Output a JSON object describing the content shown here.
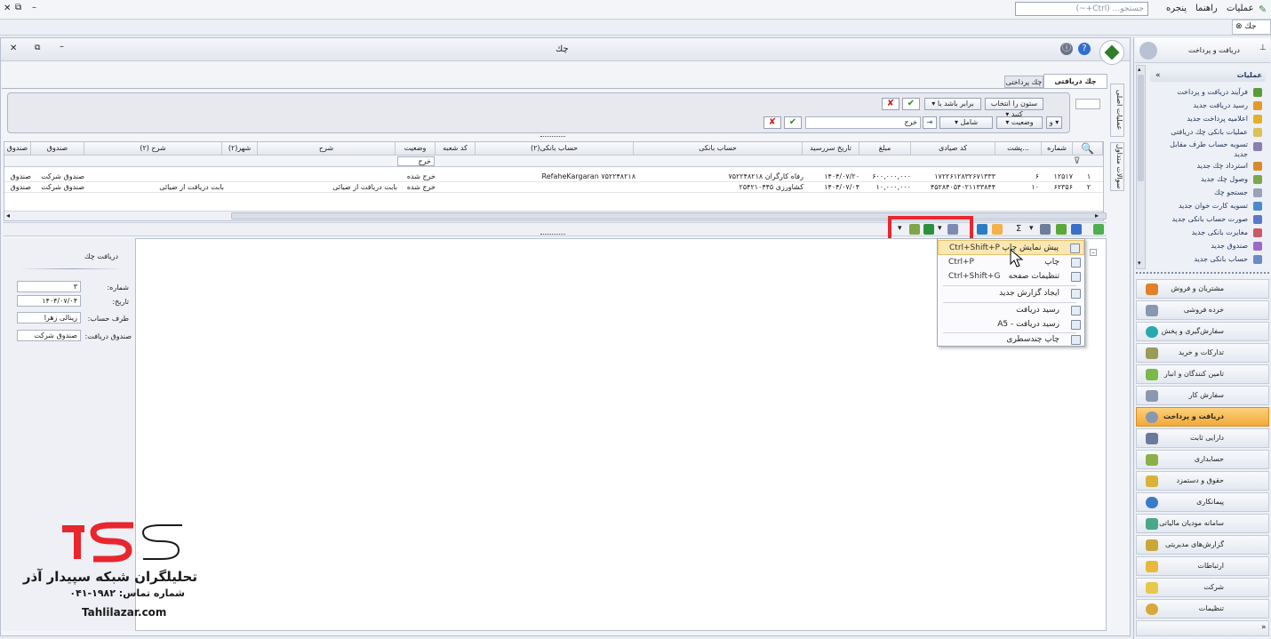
{
  "app": {
    "window_title": "چك",
    "doc_tab": "جك",
    "search_placeholder": "جستجو... (Ctrl+~)",
    "menu": [
      "عملیات",
      "راهنما",
      "پنجره"
    ]
  },
  "tabs": [
    "چك دریافتی",
    "چك پرداختی"
  ],
  "vertical_tabs": [
    "عملیات اصلی",
    "سوالات متداول"
  ],
  "filter": {
    "row1": {
      "column_dropdown": "ستون را انتخاب کنید",
      "operator_dropdown": "برابر باشد با"
    },
    "row2": {
      "logic": "و",
      "field": "وضعیت",
      "operator": "شامل",
      "value": "خرج"
    }
  },
  "grid": {
    "columns": [
      "شماره",
      "پشت...",
      "کد صیادی",
      "مبلغ",
      "تاریخ سررسید",
      "حساب بانکی",
      "حساب بانکی(۲)",
      "کد شعبه",
      "وضعیت",
      "شرح",
      "شهر(۲)",
      "شرح (۲)",
      "صندوق",
      "صندوق"
    ],
    "filter_row_value": "خرج",
    "rows": [
      {
        "index": "۱",
        "number": "۱۲۵۱۷",
        "back": "۶",
        "sayadi": "۱۷۲۲۶۱۲۸۳۲۶۷۱۳۳۳",
        "amount": "۶۰۰,۰۰۰,۰۰۰",
        "due": "۱۴۰۴/۰۷/۲۰",
        "bank": "رفاه کارگران  ۷۵۲۲۴۸۲۱۸",
        "bank2": "RefaheKargaran  ۷۵۲۲۴۸۲۱۸",
        "status": "خرج شده",
        "desc": "",
        "desc2": "",
        "fund": "صندوق شرکت",
        "fund2": "صندوق"
      },
      {
        "index": "۲",
        "number": "۶۲۳۵۶",
        "back": "۱۰",
        "sayadi": "۴۵۲۸۴۰۵۴۰۲۱۱۳۳۸۴۴",
        "amount": "۱۰,۰۰۰,۰۰۰",
        "due": "۱۴۰۴/۰۷/۰۴",
        "bank": "کشاورزی  ۲۵۴۲۱۰۴۴۵",
        "bank2": "",
        "status": "خرج شده",
        "desc": "بابت دریافت از ضیائی",
        "desc2": "بابت دریافت از ضیائی",
        "fund": "صندوق شرکت",
        "fund2": "صندوق"
      }
    ]
  },
  "detail": {
    "title": "دریافت چك",
    "fields": [
      {
        "label": "شماره:",
        "value": "۳"
      },
      {
        "label": "تاریخ:",
        "value": "۱۴۰۴/۰۷/۰۴"
      },
      {
        "label": "طرف حساب:",
        "value": "زینالی  زهرا"
      },
      {
        "label": "صندوق دریافت:",
        "value": "صندوق شرکت"
      }
    ]
  },
  "print_menu": [
    {
      "label": "پیش نمایش چاپ",
      "shortcut": "Ctrl+Shift+P"
    },
    {
      "label": "چاپ",
      "shortcut": "Ctrl+P"
    },
    {
      "label": "تنظیمات صفحه",
      "shortcut": "Ctrl+Shift+G"
    },
    {
      "label": "ایجاد گزارش جدید",
      "shortcut": ""
    },
    {
      "label": "رسید دریافت",
      "shortcut": ""
    },
    {
      "label": "رسید دریافت - A5",
      "shortcut": ""
    },
    {
      "label": "چاپ چندسطری",
      "shortcut": ""
    }
  ],
  "nav": {
    "header": "دریافت و پرداخت",
    "section": "عملیات",
    "subitems": [
      "فرآیند دریافت و پرداخت",
      "رسید دریافت جدید",
      "اعلامیه پرداخت جدید",
      "عملیات بانکی چك دریافتی",
      "تسویه حساب طرف مقابل جدید",
      "استرداد چك جدید",
      "وصول چك جدید",
      "جستجو چك",
      "تسویه کارت خوان جدید",
      "صورت حساب بانکی جدید",
      "مغایرت بانکی جدید",
      "صندوق جدید",
      "حساب بانکی جدید"
    ],
    "modules": [
      "مشتریان و فروش",
      "خرده فروشی",
      "سفارش‌گیری و پخش",
      "تدارکات و خرید",
      "تامین کنندگان و انبار",
      "سفارش کار",
      "دریافت و پرداخت",
      "دارایی ثابت",
      "حسابداری",
      "حقوق و دستمزد",
      "پیمانکاری",
      "سامانه مودیان مالیاتی",
      "گزارش‌های مدیریتی",
      "ارتباطات",
      "شرکت",
      "تنظیمات"
    ],
    "active_module": "دریافت و پرداخت"
  },
  "watermark": {
    "brand": "تحلیلگران شبکه سپیدار آذر",
    "phone": "شماره تماس: ۱۹۸۲-۰۴۱",
    "site": "Tahlilazar.com"
  },
  "colors": {
    "highlight": "#e8262e",
    "active_nav": "#f2a83a"
  }
}
